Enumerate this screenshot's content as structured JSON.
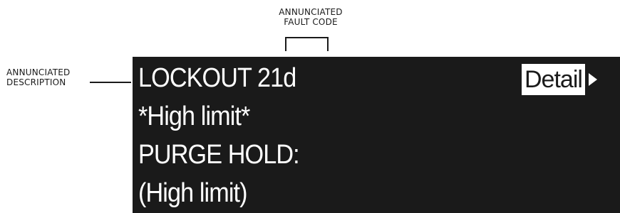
{
  "callouts": {
    "fault_code_line1": "ANNUNCIATED",
    "fault_code_line2": "FAULT CODE",
    "description_line1": "ANNUNCIATED",
    "description_line2": "DESCRIPTION"
  },
  "display": {
    "line1": "LOCKOUT 21d",
    "line2": "*High limit*",
    "line3": "PURGE HOLD:",
    "line4": "(High limit)",
    "detail_button_label": "Detail",
    "detail_arrow_icon": "right-triangle-icon"
  },
  "colors": {
    "screen_background": "#1a1a1a",
    "screen_text": "#ffffff",
    "callout_text": "#1a1a1a"
  }
}
